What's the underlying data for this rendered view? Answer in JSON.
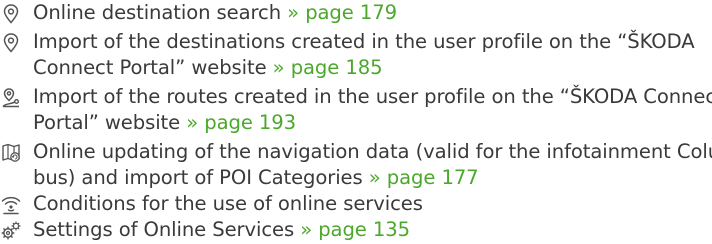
{
  "colors": {
    "text": "#3a3a3a",
    "link": "#4ca82c",
    "icon": "#555555"
  },
  "items": [
    {
      "icon": "location-pin-icon",
      "lines": [
        "Online destination search"
      ],
      "ref": "» page 179"
    },
    {
      "icon": "location-pin-icon",
      "lines": [
        "Import of the destinations created in the user profile on the “ŠKODA",
        "Connect Portal” website"
      ],
      "ref": "» page 185"
    },
    {
      "icon": "route-pins-icon",
      "lines": [
        "Import of the routes created in the user profile on the “ŠKODA Connect",
        "Portal” website"
      ],
      "ref": "» page 193"
    },
    {
      "icon": "map-update-icon",
      "lines": [
        "Online updating of the navigation data (valid for the infotainment Colum-",
        "bus) and import of POI Categories"
      ],
      "ref": "» page 177"
    },
    {
      "icon": "online-signal-icon",
      "lines": [
        "Conditions for the use of online services"
      ],
      "ref": ""
    },
    {
      "icon": "settings-gears-icon",
      "lines": [
        "Settings of Online Services"
      ],
      "ref": "» page 135"
    }
  ]
}
